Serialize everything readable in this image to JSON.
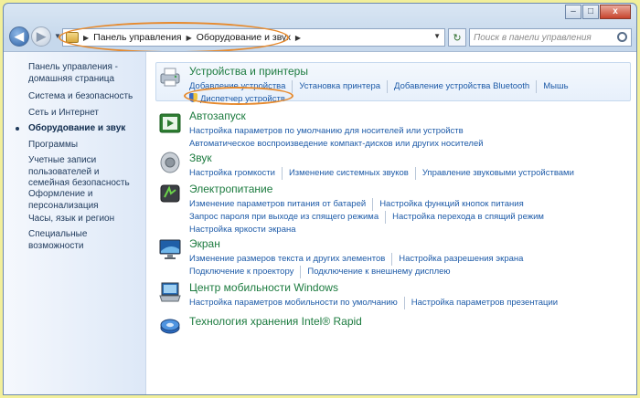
{
  "address_bar": {
    "crumbs": [
      "Панель управления",
      "Оборудование и звук"
    ]
  },
  "search": {
    "placeholder": "Поиск в панели управления"
  },
  "window_buttons": {
    "minimize": "–",
    "maximize": "□",
    "close": "x"
  },
  "sidebar": {
    "items": [
      {
        "label": "Панель управления - домашняя страница",
        "active": false
      },
      {
        "label": "Система и безопасность",
        "active": false
      },
      {
        "label": "Сеть и Интернет",
        "active": false
      },
      {
        "label": "Оборудование и звук",
        "active": true
      },
      {
        "label": "Программы",
        "active": false
      },
      {
        "label": "Учетные записи пользователей и семейная безопасность",
        "active": false
      },
      {
        "label": "Оформление и персонализация",
        "active": false
      },
      {
        "label": "Часы, язык и регион",
        "active": false
      },
      {
        "label": "Специальные возможности",
        "active": false
      }
    ]
  },
  "categories": [
    {
      "title": "Устройства и принтеры",
      "icon": "printer-icon",
      "rows": [
        [
          "Добавление устройства",
          "Установка принтера",
          "Добавление устройства Bluetooth",
          "Мышь"
        ],
        [
          "Диспетчер устройств"
        ]
      ]
    },
    {
      "title": "Автозапуск",
      "icon": "autoplay-icon",
      "rows": [
        [
          "Настройка параметров по умолчанию для носителей или устройств"
        ],
        [
          "Автоматическое воспроизведение компакт-дисков или других носителей"
        ]
      ]
    },
    {
      "title": "Звук",
      "icon": "speaker-icon",
      "rows": [
        [
          "Настройка громкости",
          "Изменение системных звуков",
          "Управление звуковыми устройствами"
        ]
      ]
    },
    {
      "title": "Электропитание",
      "icon": "power-icon",
      "rows": [
        [
          "Изменение параметров питания от батарей",
          "Настройка функций кнопок питания"
        ],
        [
          "Запрос пароля при выходе из спящего режима",
          "Настройка перехода в спящий режим"
        ],
        [
          "Настройка яркости экрана"
        ]
      ]
    },
    {
      "title": "Экран",
      "icon": "display-icon",
      "rows": [
        [
          "Изменение размеров текста и других элементов",
          "Настройка разрешения экрана"
        ],
        [
          "Подключение к проектору",
          "Подключение к внешнему дисплею"
        ]
      ]
    },
    {
      "title": "Центр мобильности Windows",
      "icon": "mobility-icon",
      "rows": [
        [
          "Настройка параметров мобильности по умолчанию",
          "Настройка параметров презентации"
        ]
      ]
    },
    {
      "title": "Технология хранения Intel® Rapid",
      "icon": "storage-icon",
      "rows": []
    }
  ]
}
